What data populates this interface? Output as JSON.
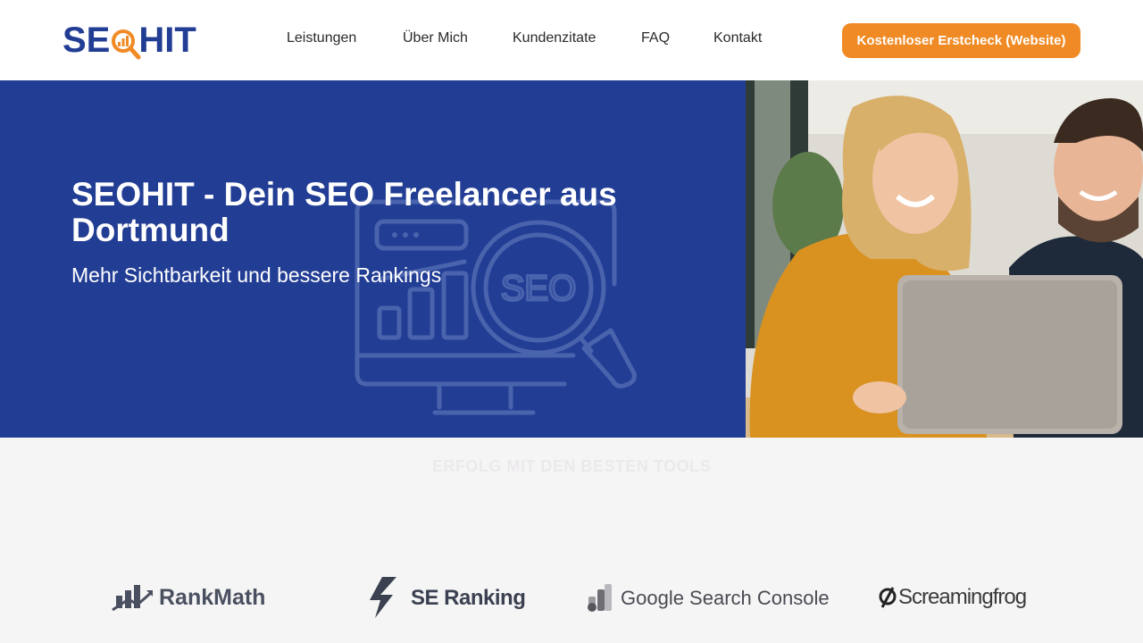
{
  "header": {
    "logo": {
      "text_left": "SE",
      "text_right": "HIT"
    },
    "nav": [
      {
        "label": "Leistungen"
      },
      {
        "label": "Über Mich"
      },
      {
        "label": "Kundenzitate"
      },
      {
        "label": "FAQ"
      },
      {
        "label": "Kontakt"
      }
    ],
    "cta_label": "Kostenloser Erstcheck (Website)"
  },
  "hero": {
    "title": "SEOHIT - Dein SEO Freelancer aus Dortmund",
    "subtitle": "Mehr Sichtbarkeit und bessere Rankings",
    "illustration_text": "SEO",
    "photo_icon": "people-laptop-photo"
  },
  "tools": {
    "heading": "ERFOLG MIT DEN BESTEN TOOLS",
    "items": [
      {
        "name": "RankMath",
        "icon": "rankmath-icon"
      },
      {
        "name": "SE Ranking",
        "icon": "se-ranking-icon"
      },
      {
        "name": "Google Search Console",
        "icon": "search-console-icon"
      },
      {
        "name": "Screamingfrog",
        "icon": "screamingfrog-icon"
      }
    ]
  },
  "colors": {
    "brand_blue": "#223d94",
    "accent_orange": "#f08a24",
    "page_bg": "#f6f5f6"
  }
}
